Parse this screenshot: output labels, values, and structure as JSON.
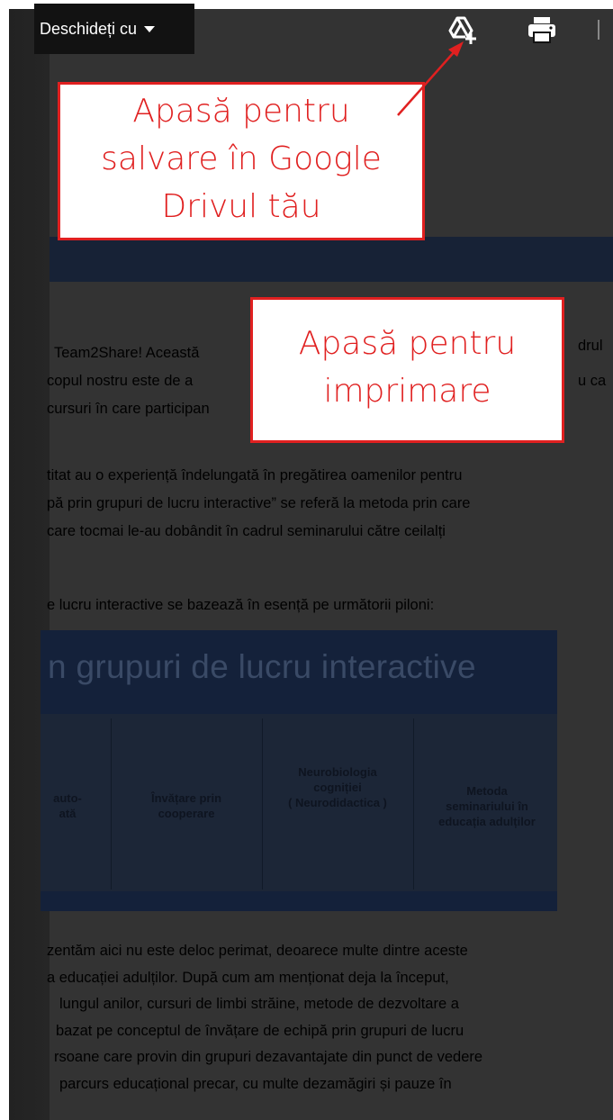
{
  "toolbar": {
    "open_with_label": "Deschideți cu",
    "drive_icon": "add-to-drive-icon",
    "print_icon": "print-icon"
  },
  "annotations": {
    "drive_lines": [
      "Apasă pentru",
      "salvare în Google",
      "Drivul tău"
    ],
    "print_lines": [
      "Apasă pentru",
      "imprimare"
    ]
  },
  "document": {
    "para1": [
      "Team2Share! Această",
      "copul nostru este de a",
      "cursuri în care participan"
    ],
    "para1_right": [
      "drul",
      "u ca"
    ],
    "para2": [
      "titat au o experiență îndelungată în pregătirea oamenilor pentru",
      "pă prin grupuri de lucru interactive” se referă la metoda prin care",
      "care tocmai le-au dobândit în cadrul seminarului către ceilalți"
    ],
    "para3": "e lucru interactive se bazează în esență pe următorii piloni:",
    "diagram": {
      "title": "n grupuri de lucru interactive",
      "columns": [
        "auto-\nată",
        "Învățare prin\ncooperare",
        "Neurobiologia\ncogniției\n( Neurodidactica )",
        "Metoda\nseminariului în\neducația adulților"
      ]
    },
    "para4": [
      "zentăm aici nu este deloc perimat, deoarece multe dintre aceste",
      "a educației adulților. După cum am menționat deja la început,",
      "lungul anilor, cursuri de limbi străine, metode de dezvoltare a",
      "bazat pe conceptul de învățare de echipă prin grupuri de lucru",
      "rsoane care provin din grupuri dezavantajate din punct de vedere",
      "parcurs educațional precar, cu multe dezamăgiri și pauze în"
    ]
  },
  "colors": {
    "callout_red": "#e02020",
    "overlay_dark": "#333333",
    "toolbar_bg": "#121212"
  }
}
